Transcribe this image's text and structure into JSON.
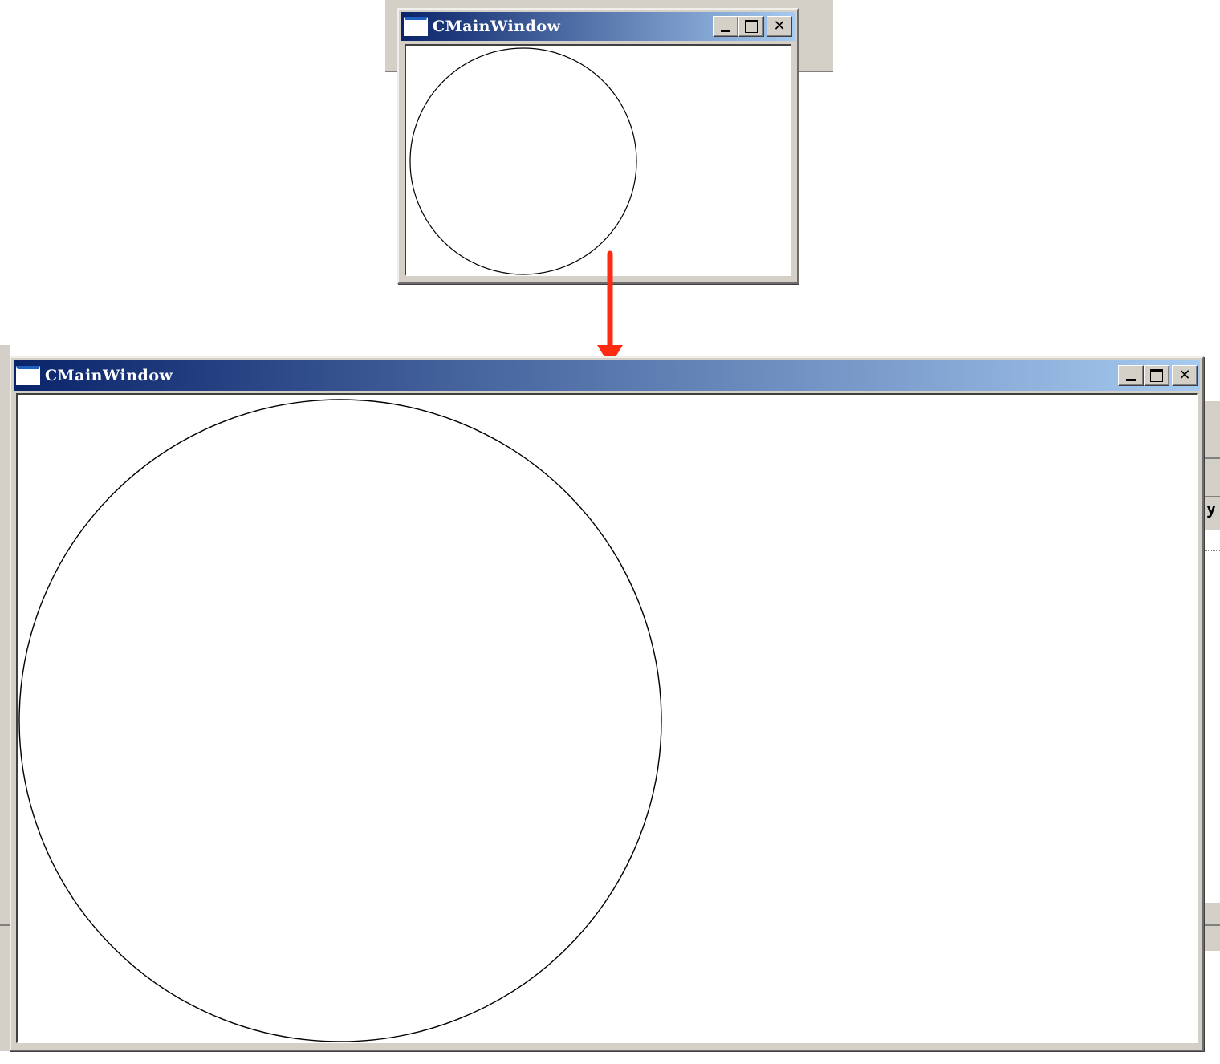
{
  "window_small": {
    "title": "CMainWindow",
    "buttons": {
      "minimize": "minimize",
      "maximize": "maximize",
      "close": "✕"
    }
  },
  "window_large": {
    "title": "CMainWindow",
    "buttons": {
      "minimize": "minimize",
      "maximize": "maximize",
      "close": "✕"
    }
  },
  "background": {
    "partial_text": "y"
  },
  "annotation": {
    "arrow_color": "#ff2a12"
  },
  "colors": {
    "titlebar_start": "#0a246a",
    "titlebar_end": "#a6caf0",
    "chrome": "#d4d0c8"
  }
}
